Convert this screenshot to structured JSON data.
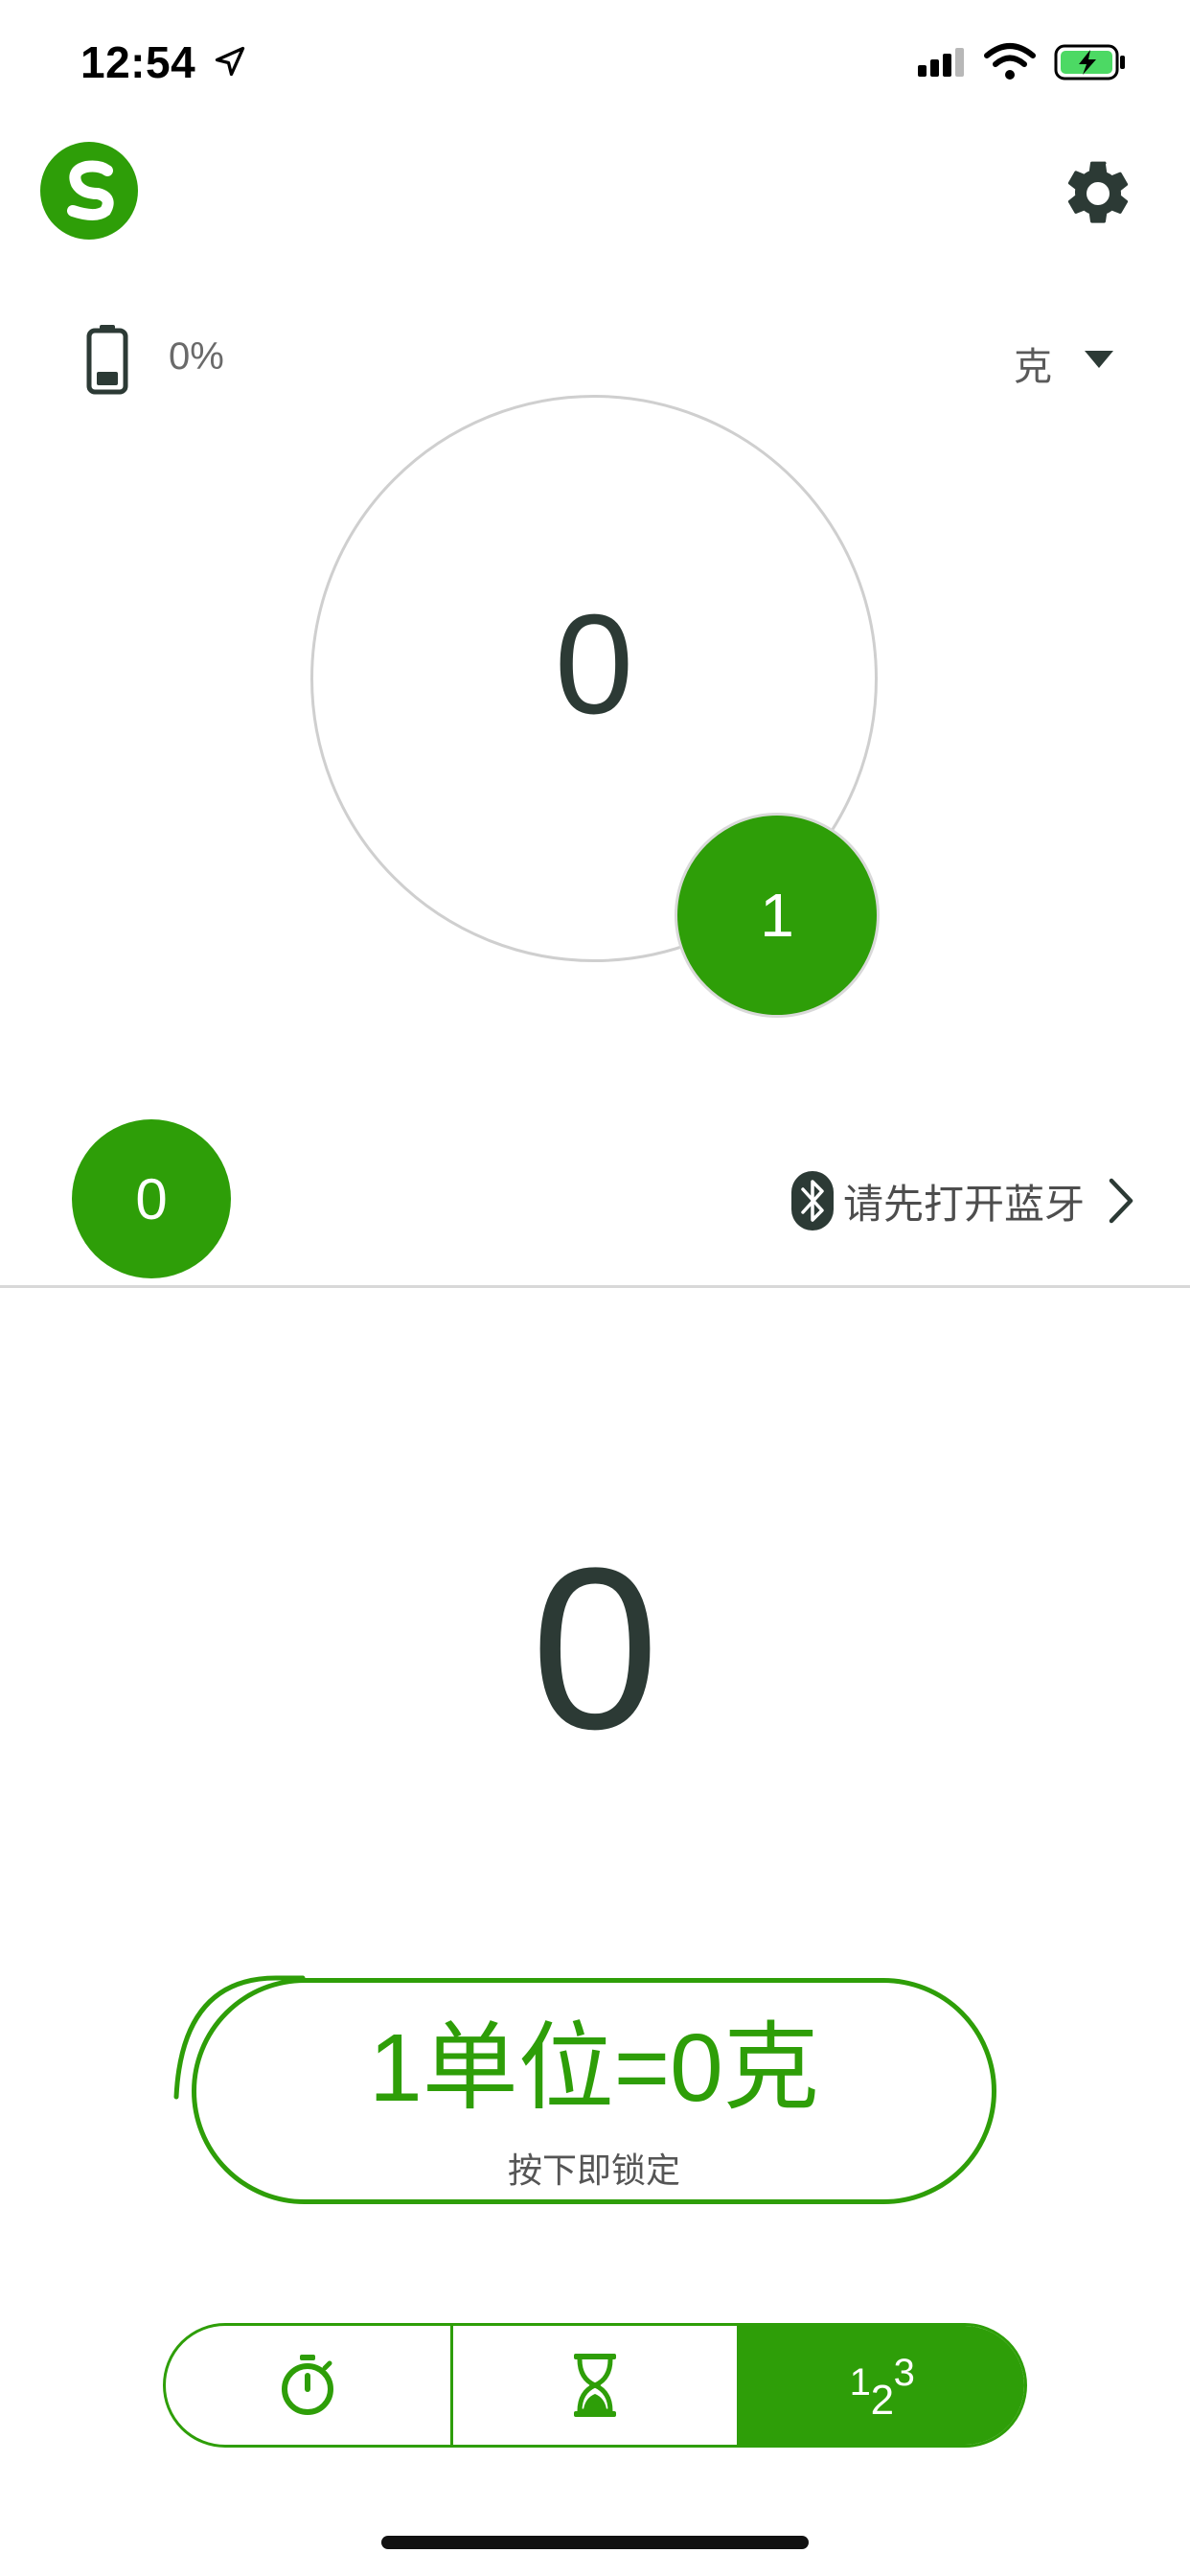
{
  "status_bar": {
    "time": "12:54"
  },
  "device": {
    "battery_percent": "0%",
    "unit": "克"
  },
  "dial": {
    "value": "0",
    "badge_value": "1"
  },
  "counter": {
    "value": "0"
  },
  "bluetooth": {
    "prompt": "请先打开蓝牙"
  },
  "readout": {
    "value": "0"
  },
  "lock_button": {
    "main_label": "1单位=0克",
    "sub_label": "按下即锁定"
  },
  "mode_tabs": [
    {
      "name": "stopwatch",
      "icon": "stopwatch-icon",
      "active": false
    },
    {
      "name": "timer",
      "icon": "hourglass-icon",
      "active": false
    },
    {
      "name": "counter",
      "icon": "counter-123-icon",
      "label_parts": [
        "1",
        "2",
        "3"
      ],
      "active": true
    }
  ],
  "colors": {
    "accent": "#2e9e08",
    "text": "#2c3a35",
    "muted": "#6a6a6a"
  }
}
